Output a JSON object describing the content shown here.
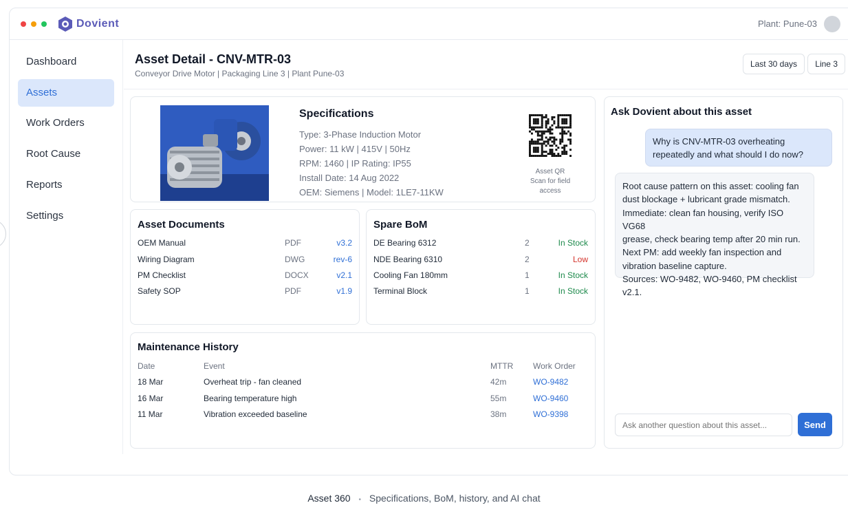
{
  "app": {
    "name": "Dovient",
    "plant_label": "Plant: Pune-03"
  },
  "colors": {
    "accent": "#2f6fd6",
    "brand": "#5b5bb8",
    "in_stock": "#1e8a4c",
    "low": "#d4332b"
  },
  "sidebar": {
    "items": [
      {
        "label": "Dashboard"
      },
      {
        "label": "Assets",
        "active": true
      },
      {
        "label": "Work Orders"
      },
      {
        "label": "Root Cause"
      },
      {
        "label": "Reports"
      },
      {
        "label": "Settings"
      }
    ]
  },
  "header": {
    "title": "Asset Detail - CNV-MTR-03",
    "subtitle": "Conveyor Drive Motor | Packaging Line 3 | Plant Pune-03",
    "filter_range": "Last 30 days",
    "filter_line": "Line 3"
  },
  "specs": {
    "title": "Specifications",
    "lines": [
      "Type: 3-Phase Induction Motor",
      "Power: 11 kW | 415V | 50Hz",
      "RPM: 1460 | IP Rating: IP55",
      "Install Date: 14 Aug 2022",
      "OEM: Siemens | Model: 1LE7-11KW"
    ],
    "qr_caption": [
      "Asset QR",
      "Scan for field",
      "access"
    ]
  },
  "documents": {
    "title": "Asset Documents",
    "rows": [
      {
        "name": "OEM Manual",
        "type": "PDF",
        "version": "v3.2"
      },
      {
        "name": "Wiring Diagram",
        "type": "DWG",
        "version": "rev-6"
      },
      {
        "name": "PM Checklist",
        "type": "DOCX",
        "version": "v2.1"
      },
      {
        "name": "Safety SOP",
        "type": "PDF",
        "version": "v1.9"
      }
    ]
  },
  "bom": {
    "title": "Spare BoM",
    "rows": [
      {
        "name": "DE Bearing 6312",
        "qty": "2",
        "status": "In Stock"
      },
      {
        "name": "NDE Bearing 6310",
        "qty": "2",
        "status": "Low"
      },
      {
        "name": "Cooling Fan 180mm",
        "qty": "1",
        "status": "In Stock"
      },
      {
        "name": "Terminal Block",
        "qty": "1",
        "status": "In Stock"
      }
    ]
  },
  "history": {
    "title": "Maintenance History",
    "columns": [
      "Date",
      "Event",
      "MTTR",
      "Work Order"
    ],
    "rows": [
      {
        "date": "18 Mar",
        "event": "Overheat trip - fan cleaned",
        "mttr": "42m",
        "wo": "WO-9482"
      },
      {
        "date": "16 Mar",
        "event": "Bearing temperature high",
        "mttr": "55m",
        "wo": "WO-9460"
      },
      {
        "date": "11 Mar",
        "event": "Vibration exceeded baseline",
        "mttr": "38m",
        "wo": "WO-9398"
      }
    ]
  },
  "chat": {
    "title": "Ask Dovient about this asset",
    "user_message": "Why is CNV-MTR-03 overheating repeatedly and what should I do now?",
    "bot_lines": [
      "Root cause pattern on this asset: cooling fan",
      "dust blockage + lubricant grade mismatch.",
      "Immediate: clean fan housing, verify ISO VG68",
      "grease, check bearing temp after 20 min run.",
      "Next PM: add weekly fan inspection and",
      "vibration baseline capture.",
      "Sources: WO-9482, WO-9460, PM checklist v2.1."
    ],
    "input_placeholder": "Ask another question about this asset...",
    "send_label": "Send"
  },
  "footer": {
    "title": "Asset 360",
    "separator": "•",
    "caption": "Specifications, BoM, history, and AI chat"
  }
}
